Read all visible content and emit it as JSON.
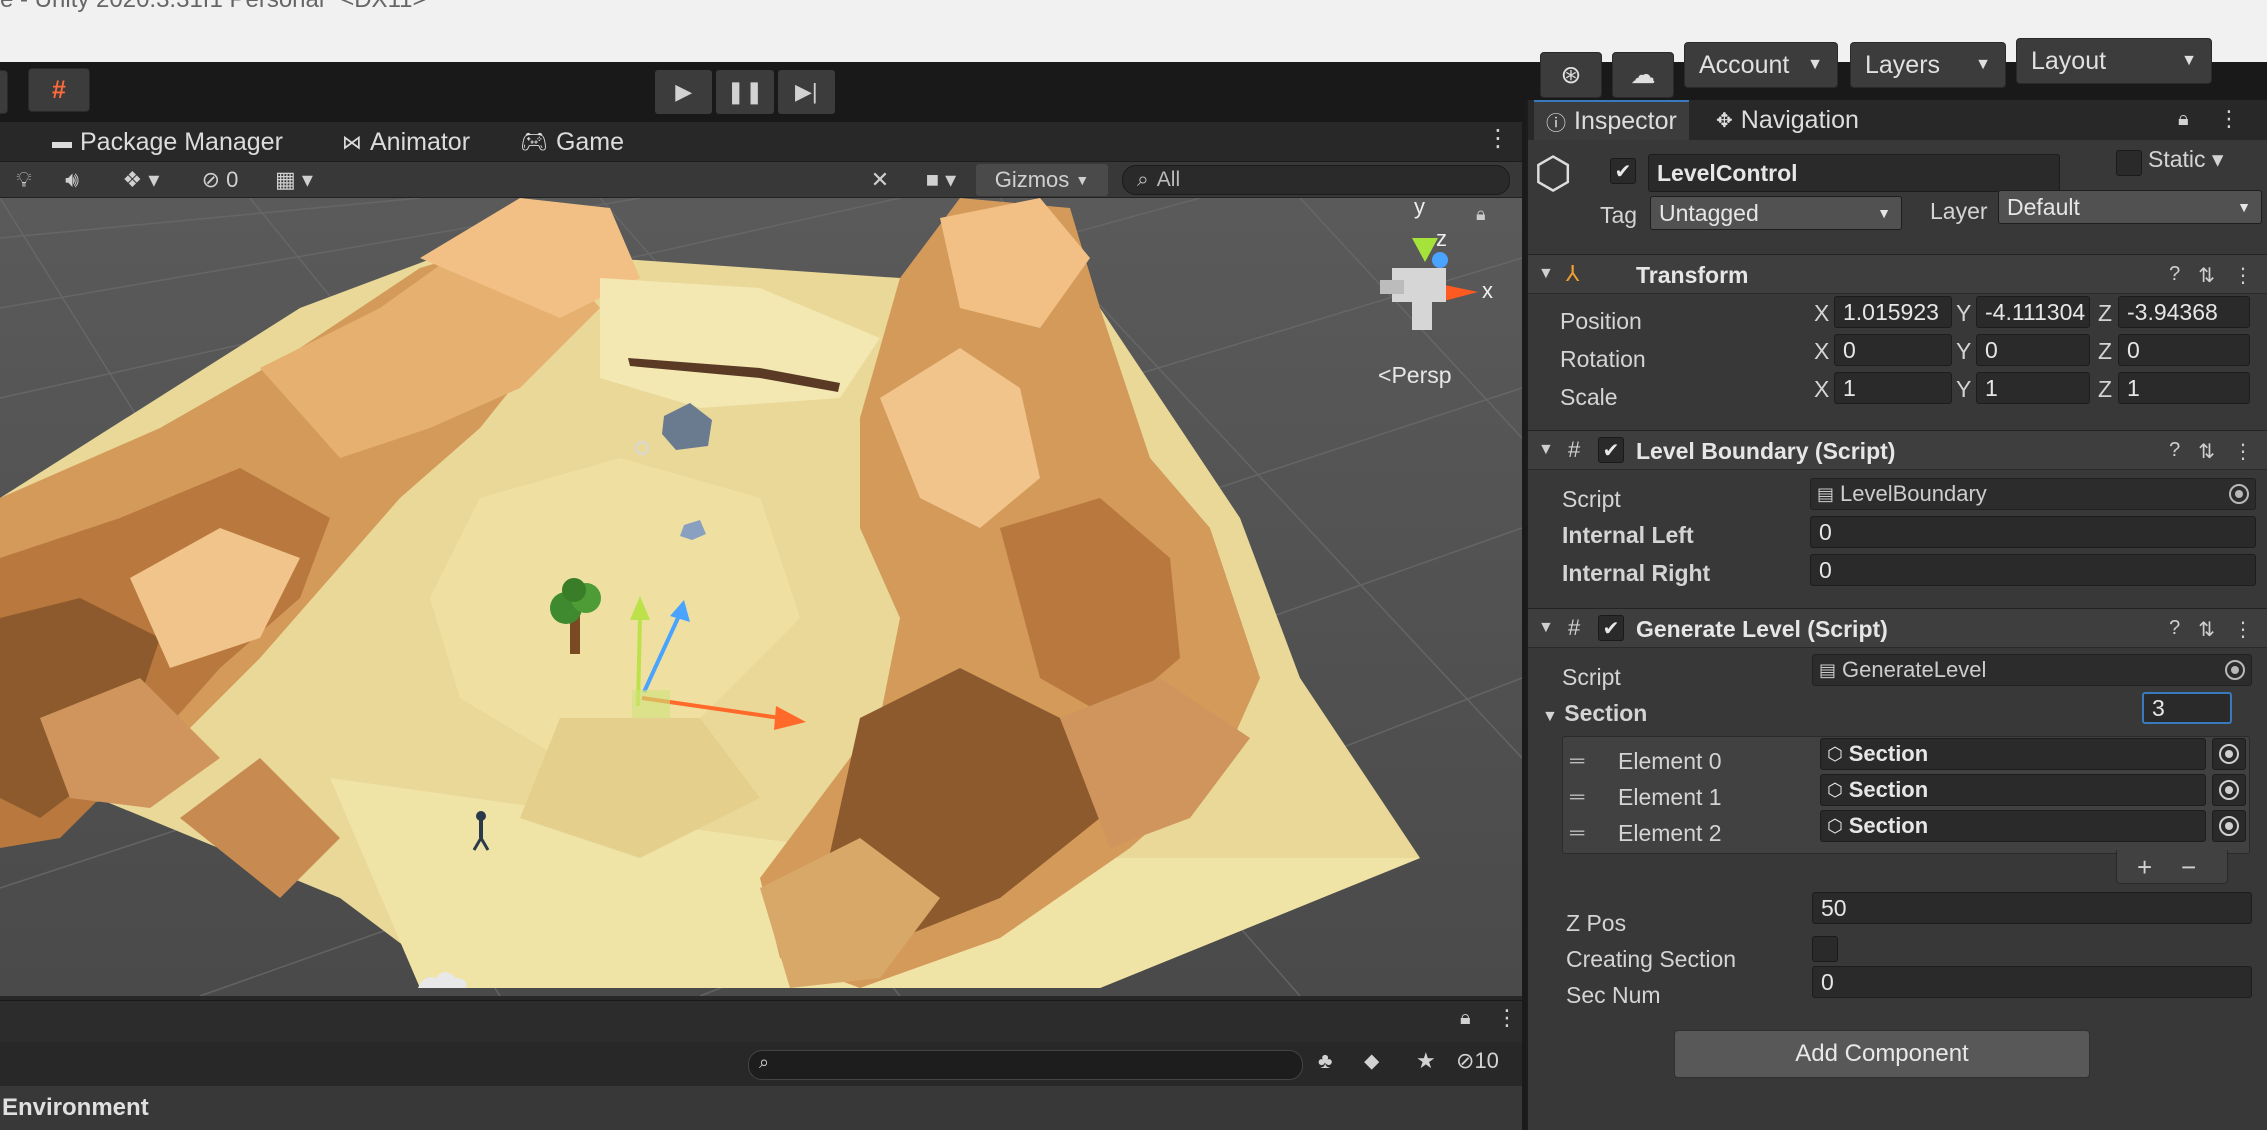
{
  "window": {
    "title": "e - Unity 2020.3.31f1 Personal* <DX11>"
  },
  "toolbar": {
    "play_icon": "play-icon",
    "pause_icon": "pause-icon",
    "step_icon": "step-icon",
    "account_label": "Account",
    "layers_label": "Layers",
    "layout_label": "Layout"
  },
  "scene": {
    "tabs": [
      {
        "label": "Package Manager",
        "icon": "package-icon"
      },
      {
        "label": "Animator",
        "icon": "animator-icon"
      },
      {
        "label": "Game",
        "icon": "gamepad-icon"
      }
    ],
    "hidden_count": "0",
    "gizmos_label": "Gizmos",
    "search_placeholder": "All",
    "persp_label": "Persp",
    "axis_x": "x",
    "axis_y": "y",
    "axis_z": "z"
  },
  "hierarchy": {
    "layer_count": "10",
    "root_label": "Environment"
  },
  "inspector": {
    "tabs": [
      {
        "label": "Inspector",
        "icon": "info-icon"
      },
      {
        "label": "Navigation",
        "icon": "navigation-icon"
      }
    ],
    "object": {
      "name": "LevelControl",
      "active": true,
      "static_label": "Static",
      "tag_label": "Tag",
      "tag_value": "Untagged",
      "layer_label": "Layer",
      "layer_value": "Default"
    },
    "transform": {
      "title": "Transform",
      "position_label": "Position",
      "rotation_label": "Rotation",
      "scale_label": "Scale",
      "position": {
        "x": "1.015923",
        "y": "-4.111304",
        "z": "-3.94368"
      },
      "rotation": {
        "x": "0",
        "y": "0",
        "z": "0"
      },
      "scale": {
        "x": "1",
        "y": "1",
        "z": "1"
      }
    },
    "level_boundary": {
      "title": "Level Boundary (Script)",
      "script_label": "Script",
      "script_value": "LevelBoundary",
      "internal_left_label": "Internal Left",
      "internal_left": "0",
      "internal_right_label": "Internal Right",
      "internal_right": "0"
    },
    "generate_level": {
      "title": "Generate Level (Script)",
      "script_label": "Script",
      "script_value": "GenerateLevel",
      "section_label": "Section",
      "section_size": "3",
      "elements": [
        {
          "label": "Element 0",
          "value": "Section"
        },
        {
          "label": "Element 1",
          "value": "Section"
        },
        {
          "label": "Element 2",
          "value": "Section"
        }
      ],
      "add_symbol": "+",
      "remove_symbol": "−",
      "zpos_label": "Z Pos",
      "zpos": "50",
      "creating_section_label": "Creating Section",
      "creating_section": false,
      "secnum_label": "Sec Num",
      "secnum": "0"
    },
    "add_component_label": "Add Component"
  }
}
